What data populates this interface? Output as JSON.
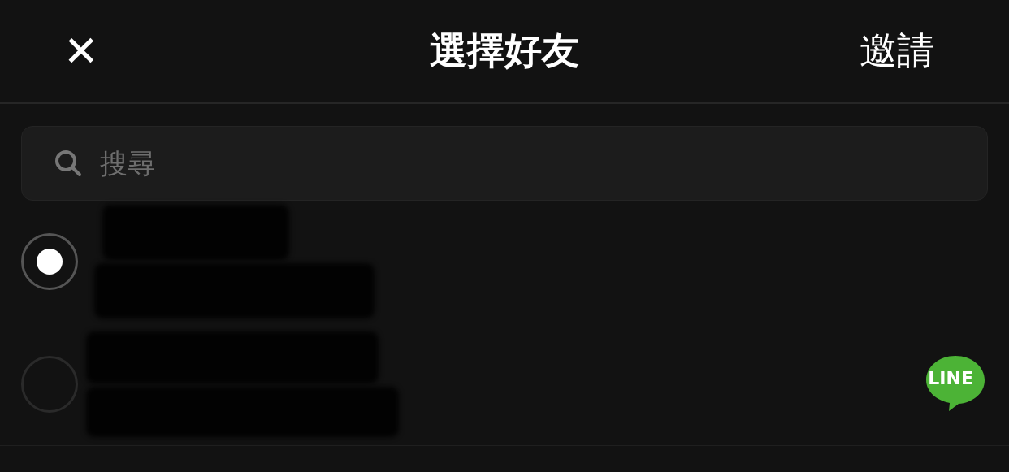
{
  "header": {
    "close_glyph": "✕",
    "title": "選擇好友",
    "action": "邀請"
  },
  "search": {
    "placeholder": "搜尋"
  },
  "friends": [
    {
      "selected": true,
      "redacted": true
    },
    {
      "selected": false,
      "redacted": true,
      "line_badge": "LINE"
    }
  ]
}
